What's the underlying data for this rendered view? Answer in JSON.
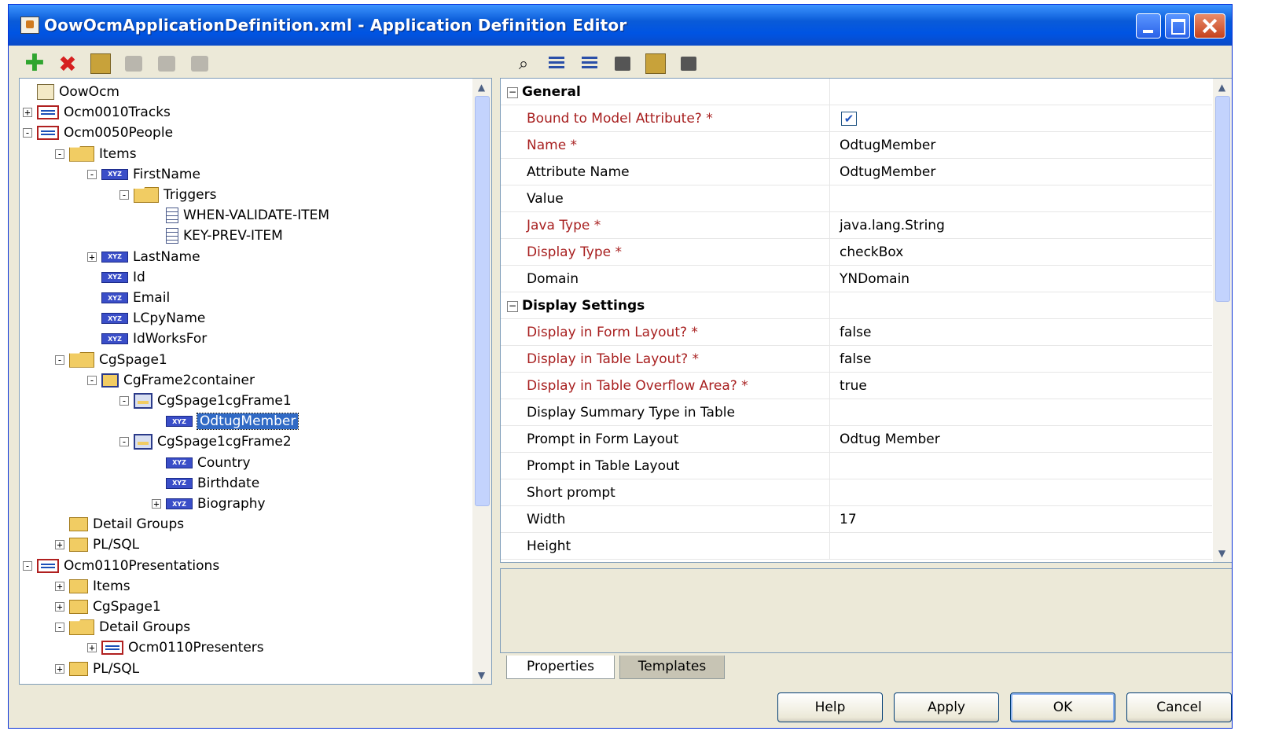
{
  "window": {
    "title": "OowOcmApplicationDefinition.xml - Application Definition Editor"
  },
  "left_toolbar": [
    "add-icon",
    "delete-icon",
    "generate-icon",
    "copy-icon",
    "expand-icon",
    "collapse-icon"
  ],
  "right_toolbar": [
    "find-icon",
    "list-icon",
    "copy-icon",
    "paste-icon",
    "user-icon",
    "palette-icon"
  ],
  "tree": [
    {
      "label": "OowOcm",
      "icon": "application",
      "level": 0,
      "toggle": ""
    },
    {
      "label": "Ocm0010Tracks",
      "icon": "table",
      "level": 0,
      "toggle": "+"
    },
    {
      "label": "Ocm0050People",
      "icon": "table",
      "level": 0,
      "toggle": "-"
    },
    {
      "label": "Items",
      "icon": "folder-open",
      "level": 1,
      "toggle": "-"
    },
    {
      "label": "FirstName",
      "icon": "item",
      "level": 2,
      "toggle": "-"
    },
    {
      "label": "Triggers",
      "icon": "folder-open",
      "level": 3,
      "toggle": "-"
    },
    {
      "label": "WHEN-VALIDATE-ITEM",
      "icon": "document",
      "level": 4,
      "toggle": ""
    },
    {
      "label": "KEY-PREV-ITEM",
      "icon": "document",
      "level": 4,
      "toggle": ""
    },
    {
      "label": "LastName",
      "icon": "item",
      "level": 2,
      "toggle": "+"
    },
    {
      "label": "Id",
      "icon": "item",
      "level": 2,
      "toggle": ""
    },
    {
      "label": "Email",
      "icon": "item",
      "level": 2,
      "toggle": ""
    },
    {
      "label": "LCpyName",
      "icon": "item",
      "level": 2,
      "toggle": ""
    },
    {
      "label": "IdWorksFor",
      "icon": "item",
      "level": 2,
      "toggle": ""
    },
    {
      "label": "CgSpage1",
      "icon": "folder-open",
      "level": 1,
      "toggle": "-"
    },
    {
      "label": "CgFrame2container",
      "icon": "container",
      "level": 2,
      "toggle": "-"
    },
    {
      "label": "CgSpage1cgFrame1",
      "icon": "frame",
      "level": 3,
      "toggle": "-"
    },
    {
      "label": "OdtugMember",
      "icon": "item",
      "level": 4,
      "toggle": "",
      "selected": true
    },
    {
      "label": "CgSpage1cgFrame2",
      "icon": "frame",
      "level": 3,
      "toggle": "-"
    },
    {
      "label": "Country",
      "icon": "item",
      "level": 4,
      "toggle": ""
    },
    {
      "label": "Birthdate",
      "icon": "item",
      "level": 4,
      "toggle": ""
    },
    {
      "label": "Biography",
      "icon": "item",
      "level": 4,
      "toggle": "+"
    },
    {
      "label": "Detail Groups",
      "icon": "folder",
      "level": 1,
      "toggle": ""
    },
    {
      "label": "PL/SQL",
      "icon": "folder",
      "level": 1,
      "toggle": "+"
    },
    {
      "label": "Ocm0110Presentations",
      "icon": "table",
      "level": 0,
      "toggle": "-"
    },
    {
      "label": "Items",
      "icon": "folder",
      "level": 1,
      "toggle": "+"
    },
    {
      "label": "CgSpage1",
      "icon": "folder",
      "level": 1,
      "toggle": "+"
    },
    {
      "label": "Detail Groups",
      "icon": "folder-open",
      "level": 1,
      "toggle": "-"
    },
    {
      "label": "Ocm0110Presenters",
      "icon": "table",
      "level": 2,
      "toggle": "+"
    },
    {
      "label": "PL/SQL",
      "icon": "folder",
      "level": 1,
      "toggle": "+"
    }
  ],
  "properties": [
    {
      "type": "category",
      "label": "General"
    },
    {
      "label": "Bound to Model Attribute? *",
      "value": "",
      "required": true,
      "checkbox": true,
      "checked": true
    },
    {
      "label": "Name *",
      "value": "OdtugMember",
      "required": true
    },
    {
      "label": "Attribute Name",
      "value": "OdtugMember",
      "required": false
    },
    {
      "label": "Value",
      "value": "",
      "required": false
    },
    {
      "label": "Java Type *",
      "value": "java.lang.String",
      "required": true
    },
    {
      "label": "Display Type *",
      "value": "checkBox",
      "required": true
    },
    {
      "label": "Domain",
      "value": "YNDomain",
      "required": false
    },
    {
      "type": "category",
      "label": "Display Settings"
    },
    {
      "label": "Display in Form Layout? *",
      "value": "false",
      "required": true
    },
    {
      "label": "Display in Table Layout? *",
      "value": "false",
      "required": true
    },
    {
      "label": "Display in Table Overflow Area? *",
      "value": "true",
      "required": true
    },
    {
      "label": "Display Summary Type in Table",
      "value": "",
      "required": false
    },
    {
      "label": "Prompt in Form Layout",
      "value": "Odtug Member",
      "required": false
    },
    {
      "label": "Prompt in Table Layout",
      "value": "",
      "required": false
    },
    {
      "label": "Short prompt",
      "value": "",
      "required": false
    },
    {
      "label": "Width",
      "value": "17",
      "required": false
    },
    {
      "label": "Height",
      "value": "",
      "required": false
    }
  ],
  "tabs": {
    "properties": "Properties",
    "templates": "Templates"
  },
  "buttons": {
    "help": "Help",
    "apply": "Apply",
    "ok": "OK",
    "cancel": "Cancel"
  }
}
